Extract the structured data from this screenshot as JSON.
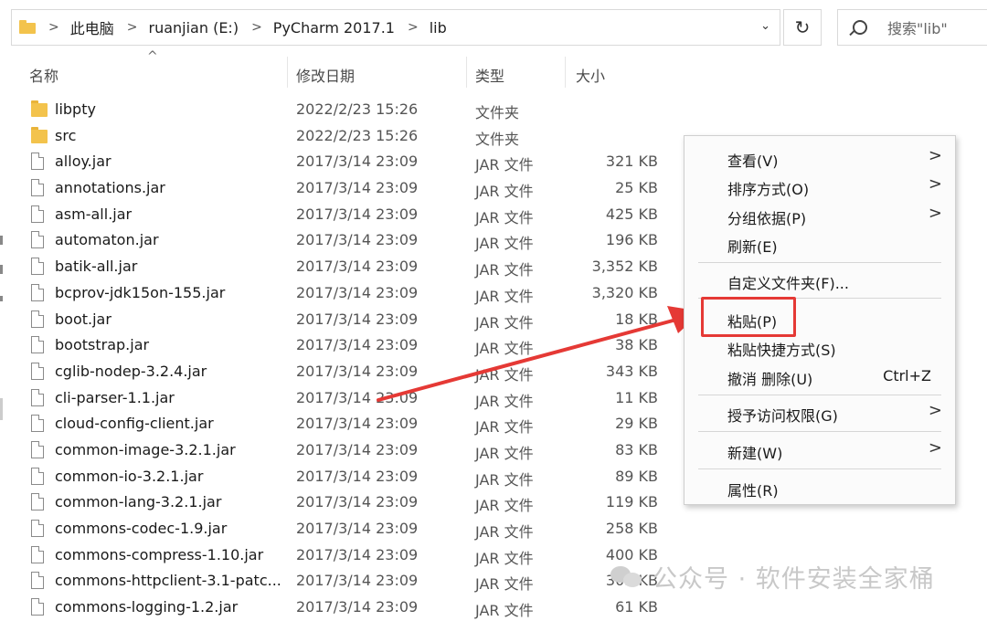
{
  "address_bar": {
    "breadcrumbs": [
      "此电脑",
      "ruanjian (E:)",
      "PyCharm 2017.1",
      "lib"
    ],
    "separator": ">",
    "dropdown_icon": "chevron-down-icon"
  },
  "refresh_icon": "refresh-icon",
  "search": {
    "placeholder": "搜索\"lib\""
  },
  "columns": {
    "name": "名称",
    "date": "修改日期",
    "type": "类型",
    "size": "大小",
    "sort_indicator": "^"
  },
  "files": [
    {
      "name": "libpty",
      "date": "2022/2/23 15:26",
      "type": "文件夹",
      "size": "",
      "kind": "folder"
    },
    {
      "name": "src",
      "date": "2022/2/23 15:26",
      "type": "文件夹",
      "size": "",
      "kind": "folder"
    },
    {
      "name": "alloy.jar",
      "date": "2017/3/14 23:09",
      "type": "JAR 文件",
      "size": "321 KB",
      "kind": "file"
    },
    {
      "name": "annotations.jar",
      "date": "2017/3/14 23:09",
      "type": "JAR 文件",
      "size": "25 KB",
      "kind": "file"
    },
    {
      "name": "asm-all.jar",
      "date": "2017/3/14 23:09",
      "type": "JAR 文件",
      "size": "425 KB",
      "kind": "file"
    },
    {
      "name": "automaton.jar",
      "date": "2017/3/14 23:09",
      "type": "JAR 文件",
      "size": "196 KB",
      "kind": "file"
    },
    {
      "name": "batik-all.jar",
      "date": "2017/3/14 23:09",
      "type": "JAR 文件",
      "size": "3,352 KB",
      "kind": "file"
    },
    {
      "name": "bcprov-jdk15on-155.jar",
      "date": "2017/3/14 23:09",
      "type": "JAR 文件",
      "size": "3,320 KB",
      "kind": "file"
    },
    {
      "name": "boot.jar",
      "date": "2017/3/14 23:09",
      "type": "JAR 文件",
      "size": "18 KB",
      "kind": "file"
    },
    {
      "name": "bootstrap.jar",
      "date": "2017/3/14 23:09",
      "type": "JAR 文件",
      "size": "38 KB",
      "kind": "file"
    },
    {
      "name": "cglib-nodep-3.2.4.jar",
      "date": "2017/3/14 23:09",
      "type": "JAR 文件",
      "size": "343 KB",
      "kind": "file"
    },
    {
      "name": "cli-parser-1.1.jar",
      "date": "2017/3/14 23:09",
      "type": "JAR 文件",
      "size": "11 KB",
      "kind": "file"
    },
    {
      "name": "cloud-config-client.jar",
      "date": "2017/3/14 23:09",
      "type": "JAR 文件",
      "size": "29 KB",
      "kind": "file"
    },
    {
      "name": "common-image-3.2.1.jar",
      "date": "2017/3/14 23:09",
      "type": "JAR 文件",
      "size": "83 KB",
      "kind": "file"
    },
    {
      "name": "common-io-3.2.1.jar",
      "date": "2017/3/14 23:09",
      "type": "JAR 文件",
      "size": "89 KB",
      "kind": "file"
    },
    {
      "name": "common-lang-3.2.1.jar",
      "date": "2017/3/14 23:09",
      "type": "JAR 文件",
      "size": "119 KB",
      "kind": "file"
    },
    {
      "name": "commons-codec-1.9.jar",
      "date": "2017/3/14 23:09",
      "type": "JAR 文件",
      "size": "258 KB",
      "kind": "file"
    },
    {
      "name": "commons-compress-1.10.jar",
      "date": "2017/3/14 23:09",
      "type": "JAR 文件",
      "size": "400 KB",
      "kind": "file"
    },
    {
      "name": "commons-httpclient-3.1-patc...",
      "date": "2017/3/14 23:09",
      "type": "JAR 文件",
      "size": "305 KB",
      "kind": "file"
    },
    {
      "name": "commons-logging-1.2.jar",
      "date": "2017/3/14 23:09",
      "type": "JAR 文件",
      "size": "61 KB",
      "kind": "file"
    }
  ],
  "context_menu": {
    "view": "查看(V)",
    "sort": "排序方式(O)",
    "group": "分组依据(P)",
    "refresh": "刷新(E)",
    "customize": "自定义文件夹(F)...",
    "paste": "粘贴(P)",
    "paste_shortcut": "粘贴快捷方式(S)",
    "undo_delete": "撤消 删除(U)",
    "undo_shortcut": "Ctrl+Z",
    "grant_access": "授予访问权限(G)",
    "new": "新建(W)",
    "properties": "属性(R)",
    "submenu_arrow": ">"
  },
  "annotation_color": "#e53935",
  "watermark": "公众号 · 软件安装全家桶"
}
